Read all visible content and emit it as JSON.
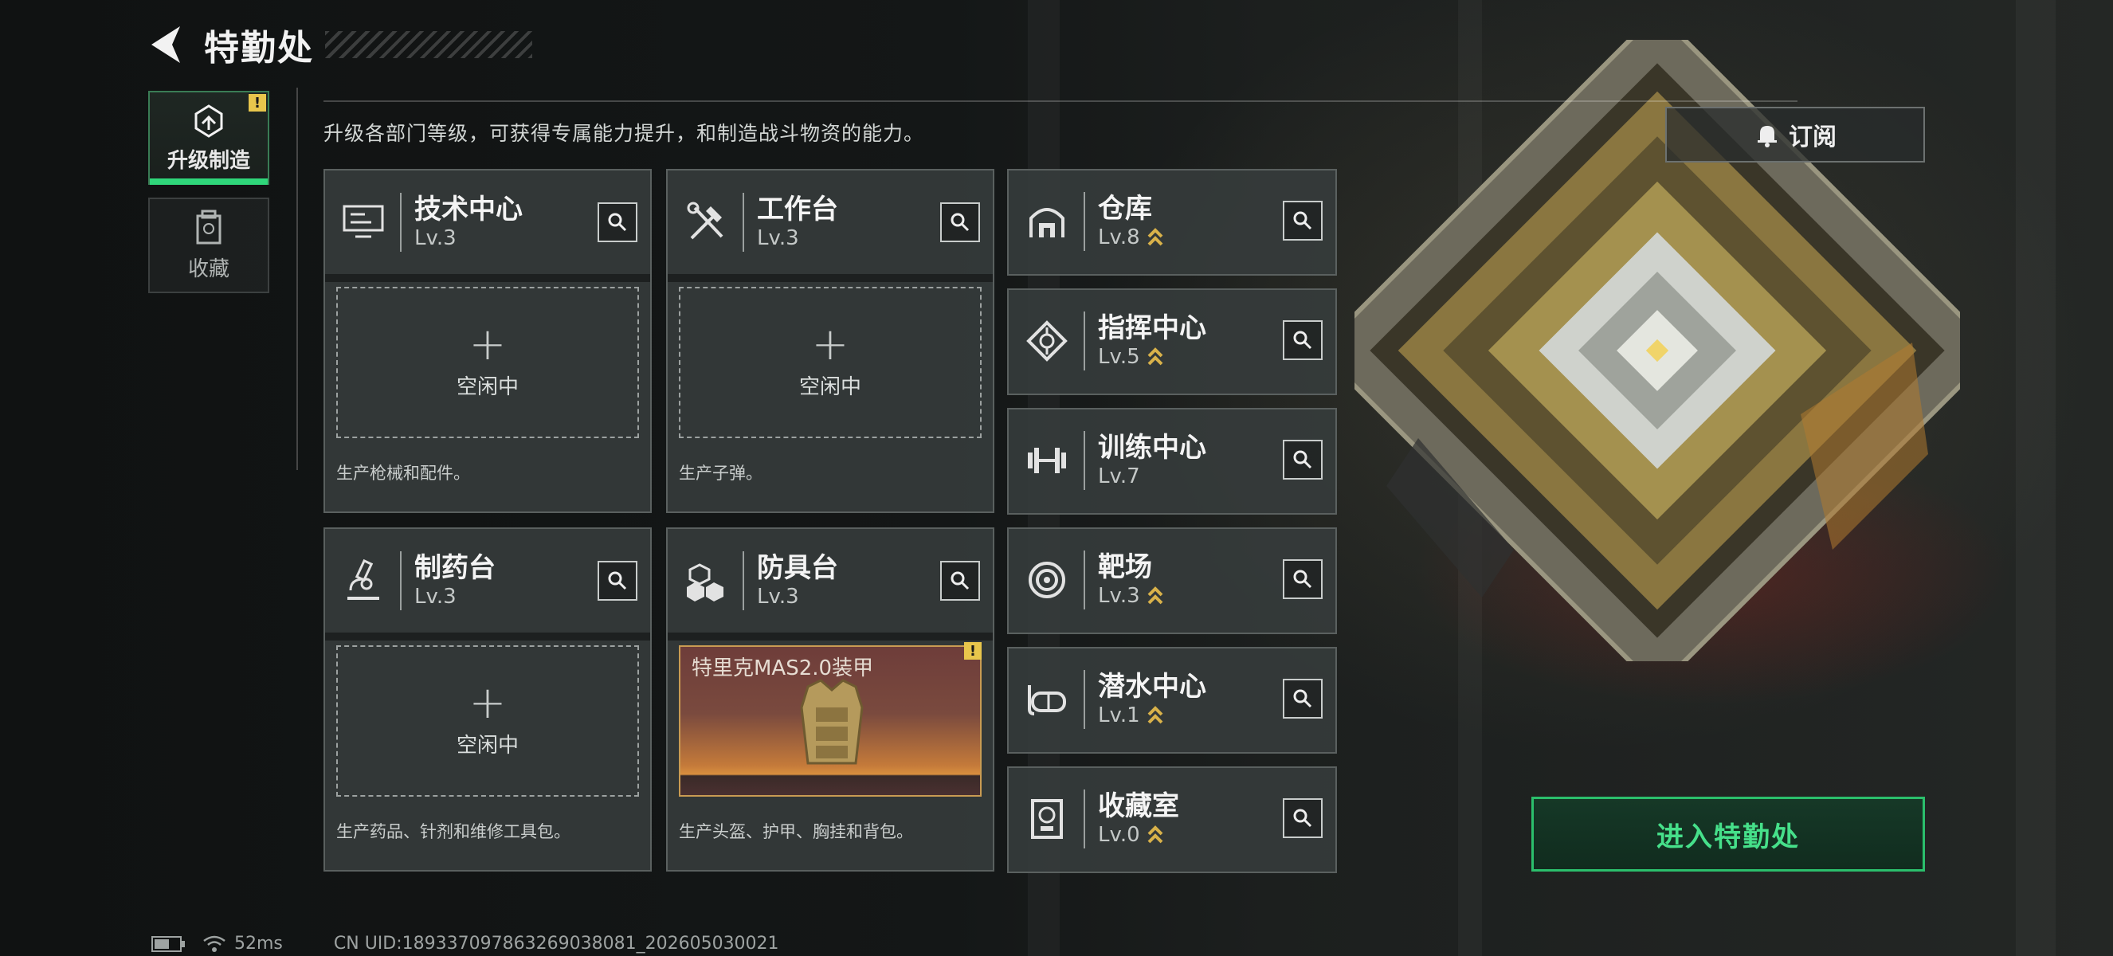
{
  "header": {
    "title": "特勤处"
  },
  "nav": [
    {
      "label": "升级制造",
      "icon": "upgrade-icon",
      "active": true,
      "badge": "!"
    },
    {
      "label": "收藏",
      "icon": "collection-icon",
      "active": false
    }
  ],
  "description": "升级各部门等级，可获得专属能力提升，和制造战斗物资的能力。",
  "subscribe": {
    "label": "订阅",
    "icon": "bell-icon"
  },
  "large_cards": [
    {
      "name": "技术中心",
      "level": "Lv.3",
      "icon": "monitor-icon",
      "slot": {
        "plus": "+",
        "status": "空闲中"
      },
      "desc": "生产枪械和配件。"
    },
    {
      "name": "工作台",
      "level": "Lv.3",
      "icon": "tools-icon",
      "slot": {
        "plus": "+",
        "status": "空闲中"
      },
      "desc": "生产子弹。"
    },
    {
      "name": "制药台",
      "level": "Lv.3",
      "icon": "microscope-icon",
      "slot": {
        "plus": "+",
        "status": "空闲中"
      },
      "desc": "生产药品、针剂和维修工具包。"
    },
    {
      "name": "防具台",
      "level": "Lv.3",
      "icon": "boxes-icon",
      "product": {
        "name": "特里克MAS2.0装甲",
        "badge": "!"
      },
      "desc": "生产头盔、护甲、胸挂和背包。"
    }
  ],
  "small_cards": [
    {
      "name": "仓库",
      "level": "Lv.8",
      "icon": "warehouse-icon",
      "upgradable": true
    },
    {
      "name": "指挥中心",
      "level": "Lv.5",
      "icon": "chip-icon",
      "upgradable": true
    },
    {
      "name": "训练中心",
      "level": "Lv.7",
      "icon": "dumbbell-icon",
      "upgradable": false
    },
    {
      "name": "靶场",
      "level": "Lv.3",
      "icon": "target-icon",
      "upgradable": true
    },
    {
      "name": "潜水中心",
      "level": "Lv.1",
      "icon": "diving-mask-icon",
      "upgradable": true
    },
    {
      "name": "收藏室",
      "level": "Lv.0",
      "icon": "trophy-icon",
      "upgradable": true
    }
  ],
  "enter_button": {
    "label": "进入特勤处"
  },
  "status_bar": {
    "ping": "52ms",
    "uid": "CN UID:1893370978632690380​81_202605030021"
  },
  "colors": {
    "accent_green": "#2fd67a",
    "badge_yellow": "#e8c64c",
    "upgrade_gold": "#d9b24a"
  }
}
